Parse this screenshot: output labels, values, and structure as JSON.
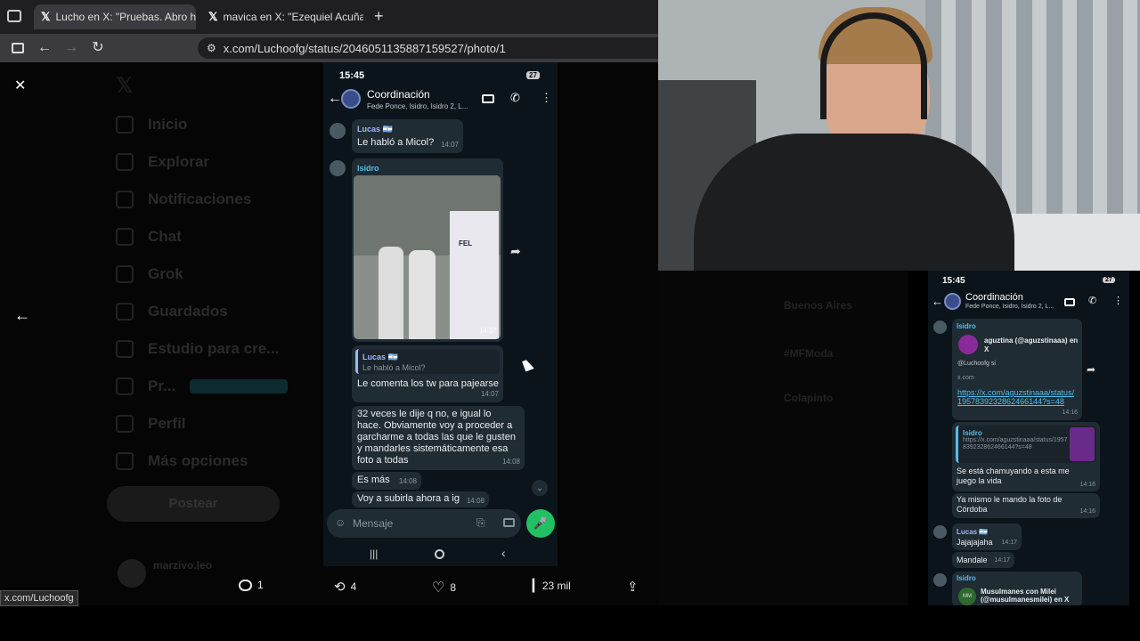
{
  "browser": {
    "tabs": [
      {
        "title": "Lucho en X: \"Pruebas. Abro hilo",
        "active": true
      },
      {
        "title": "mavica en X: \"Ezequiel Acuña, u",
        "active": false
      }
    ],
    "new_tab": "+",
    "url": "x.com/Luchoofg/status/2046051135887159527/photo/1",
    "status_url": "x.com/Luchoofg"
  },
  "x": {
    "close": "✕",
    "nav": [
      "Inicio",
      "Explorar",
      "Notificaciones",
      "Chat",
      "Grok",
      "Guardados",
      "Estudio para cre...",
      "Pr...",
      "Perfil",
      "Más opciones"
    ],
    "post_button": "Postear",
    "profile_name": "marzivo.leo",
    "trends": [
      "Buenos Aires",
      "#MFModa",
      "Colapinto"
    ],
    "actions": {
      "replies": "1",
      "reposts": "4",
      "likes": "8",
      "views": "23 mil"
    }
  },
  "phone": {
    "time": "15:45",
    "battery": "27",
    "chat_name": "Coordinación",
    "members": "Fede Ponce, Isidro, Isidro 2, L...",
    "messages": [
      {
        "sender": "Lucas 🇦🇷",
        "text": "Le habló a Micol?",
        "time": "14:07"
      },
      {
        "sender": "Isidro",
        "text": "",
        "time": "14:07",
        "image": true,
        "image_text": "FEL"
      },
      {
        "quote_sender": "Lucas 🇦🇷",
        "quote": "Le habló a Micol?",
        "text": "Le comenta los tw para pajearse",
        "time": "14:07"
      },
      {
        "text": "32 veces le dije q no, e igual lo hace. Obviamente voy a proceder a garcharme a todas las que le gusten y mandarles sistemáticamente esa foto a todas",
        "time": "14:08"
      },
      {
        "text": "Es más",
        "time": "14:08"
      },
      {
        "text": "Voy a subirla ahora a ig",
        "time": "14:08"
      }
    ],
    "input_placeholder": "Mensaje"
  },
  "rphone": {
    "time": "15:45",
    "battery": "27",
    "chat_name": "Coordinación",
    "members": "Fede Ponce, Isidro, Isidro 2, L...",
    "sender1": "Isidro",
    "link_title": "aguztina (@aguzstinaaa) en X",
    "link_desc": "@Luchoofg si",
    "link_domain": "x.com",
    "link_url": "https://x.com/aguzstinaaa/status/1957839232862466144?s=48",
    "t1": "14:16",
    "quote_sender": "Isidro",
    "quote_url": "https://x.com/aguzstinaaa/status/1957839232862466144?s=48",
    "msg2": "Se está chamuyando a esta me juego la vida",
    "t2": "14:16",
    "msg3": "Ya mismo le mando la foto de Córdoba",
    "t3": "14:16",
    "sender2": "Lucas 🇦🇷",
    "msg4": "Jajajajaha",
    "t4": "14:17",
    "msg5": "Mandale",
    "t5": "14:17",
    "sender3": "Isidro",
    "msg6": "Musulmanes con Milei (@musulmanesmilei) en X",
    "avatar_text": "MM"
  },
  "colors": {
    "accent_green": "#21c063",
    "sender_lucas": "#a5b4fc",
    "sender_isidro": "#53bdeb",
    "link": "#53bdeb"
  }
}
